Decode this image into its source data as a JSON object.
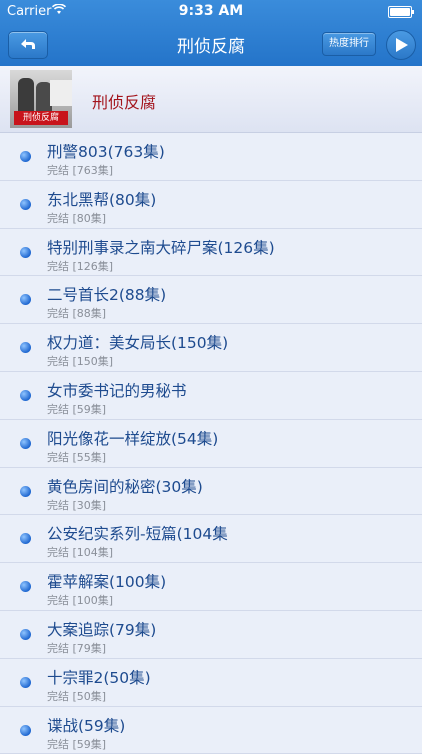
{
  "status_bar": {
    "carrier": "Carrier",
    "time": "9:33 AM"
  },
  "nav": {
    "title": "刑侦反腐",
    "rank_button": "热度排行"
  },
  "header": {
    "title": "刑侦反腐",
    "thumbnail_label": "刑侦反腐"
  },
  "list": [
    {
      "title": "刑警803(763集)",
      "sub": "完结 [763集]"
    },
    {
      "title": "东北黑帮(80集)",
      "sub": "完结 [80集]"
    },
    {
      "title": "特别刑事录之南大碎尸案(126集)",
      "sub": "完结 [126集]"
    },
    {
      "title": "二号首长2(88集)",
      "sub": "完结 [88集]"
    },
    {
      "title": "权力道：美女局长(150集)",
      "sub": "完结 [150集]"
    },
    {
      "title": "女市委书记的男秘书",
      "sub": "完结 [59集]"
    },
    {
      "title": "阳光像花一样绽放(54集)",
      "sub": "完结 [55集]"
    },
    {
      "title": "黄色房间的秘密(30集)",
      "sub": "完结 [30集]"
    },
    {
      "title": "公安纪实系列-短篇(104集",
      "sub": "完结 [104集]"
    },
    {
      "title": "霍苹解案(100集)",
      "sub": "完结 [100集]"
    },
    {
      "title": "大案追踪(79集)",
      "sub": "完结 [79集]"
    },
    {
      "title": "十宗罪2(50集)",
      "sub": "完结 [50集]"
    },
    {
      "title": "谍战(59集)",
      "sub": "完结 [59集]"
    }
  ]
}
